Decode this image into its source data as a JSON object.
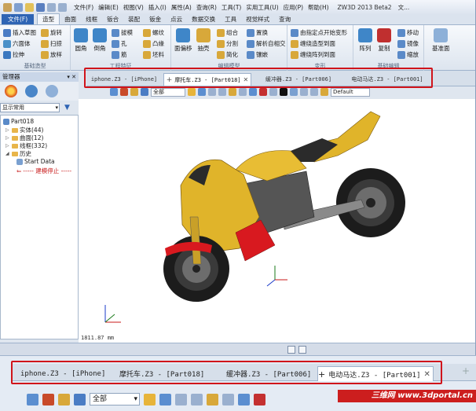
{
  "menubar": {
    "items": [
      "文件(F)",
      "编辑(E)",
      "视图(V)",
      "插入(I)",
      "属性(A)",
      "查询(R)",
      "工具(T)",
      "实用工具(U)",
      "应用(P)",
      "帮助(H)"
    ],
    "app_title": "ZW3D 2013 Beta2",
    "title_tail": "文..."
  },
  "ribbon_tabs": {
    "file": "文件(F)",
    "items": [
      "造型",
      "曲面",
      "线框",
      "钣合",
      "装配",
      "钣金",
      "点云",
      "数据交换",
      "工具",
      "视觉样式",
      "查询"
    ],
    "active": "造型"
  },
  "ribbon": {
    "group1": {
      "name": "基础造型",
      "items": [
        "插入草图",
        "旋转",
        "六面体",
        "扫掠",
        "拉伸",
        "放样"
      ]
    },
    "group2": {
      "name": "工程特征",
      "big": [
        "圆角",
        "倒角"
      ],
      "items": [
        "拔模",
        "螺纹",
        "孔",
        "凸缘",
        "筋",
        "坯料"
      ]
    },
    "group3": {
      "name": "编辑模型",
      "big": [
        "面偏移",
        "抽壳"
      ],
      "items": [
        "组合",
        "置换",
        "分割",
        "解析自相交",
        "简化",
        "镶嵌"
      ]
    },
    "group4": {
      "name": "变形",
      "items": [
        "由指定点开始变形",
        "缠绕造型到面",
        "缠绕阵列到面"
      ]
    },
    "group5": {
      "name": "基础编辑",
      "big": [
        "阵列",
        "复制"
      ],
      "items": [
        "移动",
        "镜像",
        "缩放"
      ]
    },
    "group6": {
      "name": "",
      "big": [
        "基准面"
      ]
    }
  },
  "doc_tabs": [
    {
      "label": "iphone.Z3 - [iPhone]",
      "active": false
    },
    {
      "label": "摩托车.Z3 - [Part018]",
      "active": true
    },
    {
      "label": "缓冲器.Z3 - [Part006]",
      "active": false
    },
    {
      "label": "电动马达.Z3 - [Part001]",
      "active": false
    }
  ],
  "manager": {
    "title": "管理器",
    "pin": "▾ ✕",
    "filter": "显示常用",
    "tree": {
      "root": "Part018",
      "items": [
        "实体(44)",
        "曲面(12)",
        "线框(332)",
        "历史"
      ],
      "history_items": [
        "Start Data"
      ],
      "stop_label": "----- 建模停止 -----"
    }
  },
  "view_toolbar": {
    "filter": "全部",
    "style": "Default"
  },
  "viewport": {
    "readout": "1811.87 mm"
  },
  "zoom_tabs": [
    {
      "label": "iphone.Z3 - [iPhone]",
      "active": false
    },
    {
      "label": "摩托车.Z3 - [Part018]",
      "active": false
    },
    {
      "label": "缓冲器.Z3 - [Part006]",
      "active": false
    },
    {
      "label": "电动马达.Z3 - [Part001]",
      "active": true
    }
  ],
  "zoom_toolbar": {
    "filter": "全部"
  },
  "watermark": "三维网 www.3dportal.cn",
  "colors": {
    "highlight": "#d0141b",
    "file_tab": "#2e64b4",
    "bike_body": "#e0b42a",
    "bike_red": "#d8191f"
  }
}
